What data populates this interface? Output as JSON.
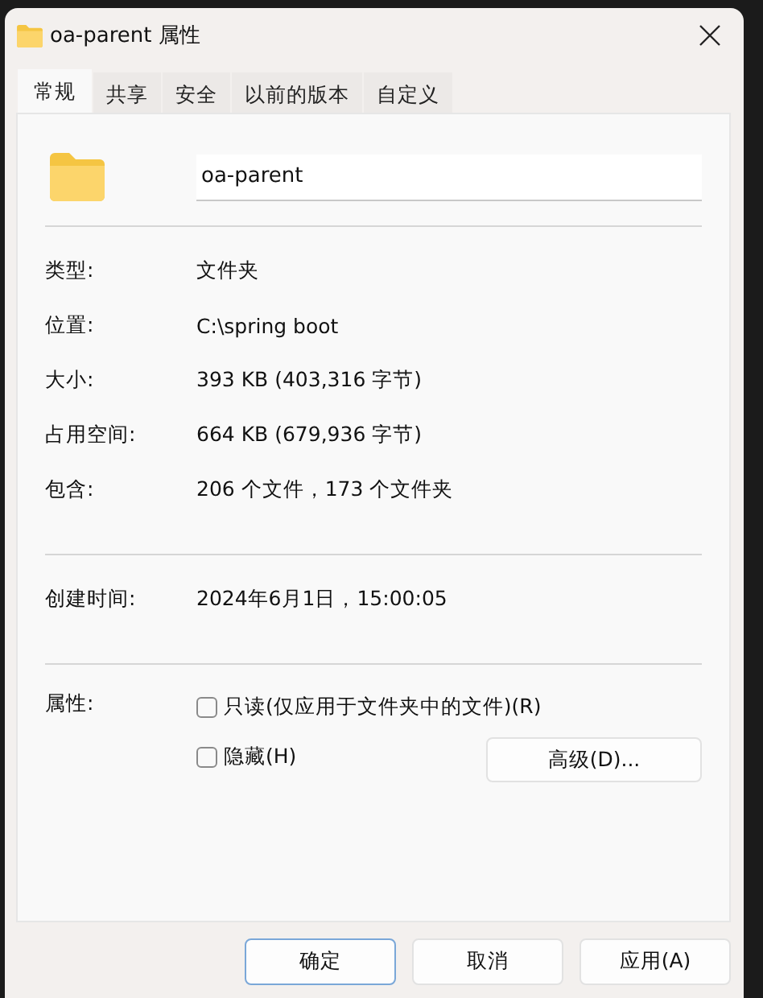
{
  "window": {
    "title": "oa-parent 属性"
  },
  "tabs": [
    {
      "label": "常规",
      "selected": true
    },
    {
      "label": "共享",
      "selected": false
    },
    {
      "label": "安全",
      "selected": false
    },
    {
      "label": "以前的版本",
      "selected": false
    },
    {
      "label": "自定义",
      "selected": false
    }
  ],
  "name_field": {
    "value": "oa-parent"
  },
  "groups": [
    [
      {
        "label": "类型:",
        "value": "文件夹"
      },
      {
        "label": "位置:",
        "value": "C:\\spring boot"
      },
      {
        "label": "大小:",
        "value": "393 KB (403,316 字节)"
      },
      {
        "label": "占用空间:",
        "value": "664 KB (679,936 字节)"
      },
      {
        "label": "包含:",
        "value": "206 个文件，173 个文件夹"
      }
    ],
    [
      {
        "label": "创建时间:",
        "value": "2024年6月1日，15:00:05"
      }
    ]
  ],
  "attributes": {
    "label": "属性:",
    "checkboxes": [
      {
        "label": "只读(仅应用于文件夹中的文件)(R)",
        "checked": false
      },
      {
        "label": "隐藏(H)",
        "checked": false
      }
    ],
    "advanced_button": "高级(D)..."
  },
  "buttons": [
    {
      "label": "确定",
      "default": true
    },
    {
      "label": "取消",
      "default": false
    },
    {
      "label": "应用(A)",
      "default": false
    }
  ]
}
